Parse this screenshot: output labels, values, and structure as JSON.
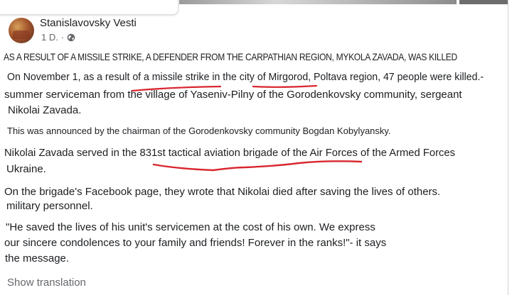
{
  "post": {
    "page_name": "Stanislavovsky Vesti",
    "time": "1 D.",
    "headline": "AS A RESULT OF A MISSILE STRIKE, A DEFENDER FROM THE CARPATHIAN REGION, MYKOLA ZAVADA, WAS KILLED",
    "lines": [
      "On November 1, as a result of a missile strike in the city of Mirgorod, Poltava region, 47 people were killed.-",
      "summer serviceman from the village of Yaseniv-Pilny of the Gorodenkovsky community, sergeant",
      "Nikolai Zavada.",
      "This was announced by the chairman of the Gorodenkovsky community Bogdan Kobylyansky.",
      "Nikolai Zavada served in the 831st tactical aviation brigade of the Air Forces of the Armed Forces",
      "Ukraine.",
      "On the brigade's Facebook page, they wrote that Nikolai died after saving the lives of others.",
      "military personnel.",
      "\"He saved the lives of his unit's servicemen at the cost of his own. We express",
      "our sincere condolences to your family and friends! Forever in the ranks!\"- it says",
      "the message."
    ],
    "show_translation": "Show translation"
  },
  "icons": {
    "privacy": "globe-icon"
  },
  "colors": {
    "annotation": "#d8262f",
    "muted": "#65676b"
  }
}
